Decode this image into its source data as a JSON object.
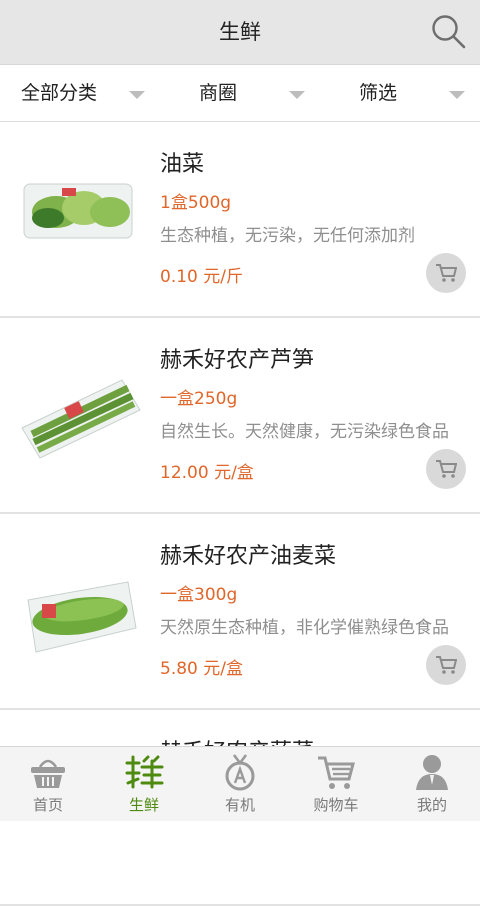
{
  "header": {
    "title": "生鲜",
    "search_icon": "search-icon"
  },
  "filters": [
    {
      "label": "全部分类"
    },
    {
      "label": "商圈"
    },
    {
      "label": "筛选"
    }
  ],
  "products": [
    {
      "name": "油菜",
      "spec": "1盒500g",
      "desc": "生态种植，无污染，无任何添加剂",
      "price": "0.10 元/斤"
    },
    {
      "name": "赫禾好农产芦笋",
      "spec": "一盒250g",
      "desc": "自然生长。天然健康，无污染绿色食品",
      "price": "12.00 元/盒"
    },
    {
      "name": "赫禾好农产油麦菜",
      "spec": "一盒300g",
      "desc": "天然原生态种植，非化学催熟绿色食品",
      "price": "5.80 元/盒"
    },
    {
      "name": "赫禾好农产菠菜"
    }
  ],
  "tabs": [
    {
      "label": "首页",
      "icon": "basket-icon",
      "active": false
    },
    {
      "label": "生鲜",
      "icon": "fresh-icon",
      "active": true
    },
    {
      "label": "有机",
      "icon": "organic-badge-icon",
      "active": false
    },
    {
      "label": "购物车",
      "icon": "cart-icon",
      "active": false
    },
    {
      "label": "我的",
      "icon": "user-icon",
      "active": false
    }
  ],
  "colors": {
    "accent": "#e0662a",
    "active_tab": "#4f8a10",
    "header_bg": "#e6e6e6"
  }
}
